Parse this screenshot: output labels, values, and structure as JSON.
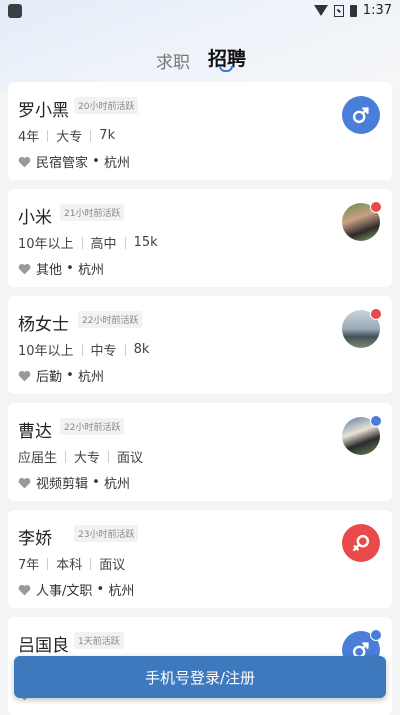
{
  "status_bar": {
    "time": "1:37"
  },
  "tabs": [
    {
      "label": "求职"
    },
    {
      "label": "招聘"
    }
  ],
  "candidates": [
    {
      "name": "罗小黑",
      "active": "20小时前活跃",
      "experience": "4年",
      "education": "大专",
      "salary": "7k",
      "job": "民宿管家",
      "city": "杭州",
      "gender": "male",
      "avatar": "male-icon"
    },
    {
      "name": "小米",
      "active": "21小时前活跃",
      "experience": "10年以上",
      "education": "高中",
      "salary": "15k",
      "job": "其他",
      "city": "杭州",
      "gender": "female",
      "avatar": "photo"
    },
    {
      "name": "杨女士",
      "active": "22小时前活跃",
      "experience": "10年以上",
      "education": "中专",
      "salary": "8k",
      "job": "后勤",
      "city": "杭州",
      "gender": "female",
      "avatar": "photo"
    },
    {
      "name": "曹达",
      "active": "22小时前活跃",
      "experience": "应届生",
      "education": "大专",
      "salary": "面议",
      "job": "视频剪辑",
      "city": "杭州",
      "gender": "male",
      "avatar": "photo"
    },
    {
      "name": "李娇",
      "active": "23小时前活跃",
      "experience": "7年",
      "education": "本科",
      "salary": "面议",
      "job": "人事/文职",
      "city": "杭州",
      "gender": "female",
      "avatar": "female-icon"
    },
    {
      "name": "吕国良",
      "active": "1天前活跃",
      "experience": "",
      "education": "",
      "salary": "",
      "job": "",
      "city": "",
      "gender": "male",
      "avatar": "male-icon"
    }
  ],
  "login_button": {
    "label": "手机号登录/注册"
  },
  "colors": {
    "accent": "#3e79be",
    "male": "#4a7fd9",
    "female": "#e84a4a"
  }
}
